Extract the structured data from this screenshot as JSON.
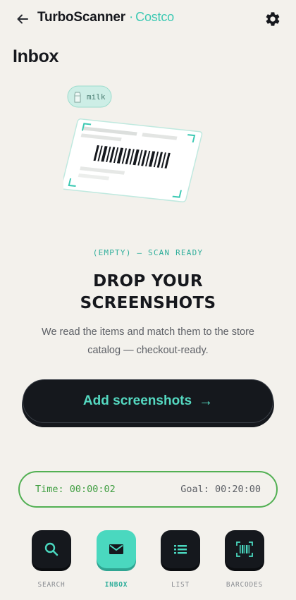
{
  "header": {
    "app_name": "TurboScanner",
    "store_separator": "·",
    "store_name": "Costco",
    "back_icon": "arrow-left-icon",
    "settings_icon": "gear-icon"
  },
  "page": {
    "title": "Inbox"
  },
  "illustration": {
    "tag_label": "milk"
  },
  "empty_state": {
    "status": "(EMPTY) — SCAN READY",
    "headline_line1": "DROP YOUR",
    "headline_line2": "SCREENSHOTS",
    "description": "We read the items and match them to the store catalog — checkout-ready.",
    "button_label": "Add screenshots",
    "button_arrow": "→"
  },
  "timer": {
    "time_text": "Time: 00:00:02",
    "goal_text": "Goal: 00:20:00"
  },
  "nav": {
    "items": [
      {
        "label": "SEARCH",
        "icon": "search-icon",
        "active": false
      },
      {
        "label": "INBOX",
        "icon": "mail-icon",
        "active": true
      },
      {
        "label": "LIST",
        "icon": "list-icon",
        "active": false
      },
      {
        "label": "BARCODES",
        "icon": "barcode-icon",
        "active": false
      }
    ]
  },
  "colors": {
    "background": "#f3f1ec",
    "accent": "#4ad8bf",
    "dark": "#15181d",
    "timer_green": "#52b053"
  }
}
